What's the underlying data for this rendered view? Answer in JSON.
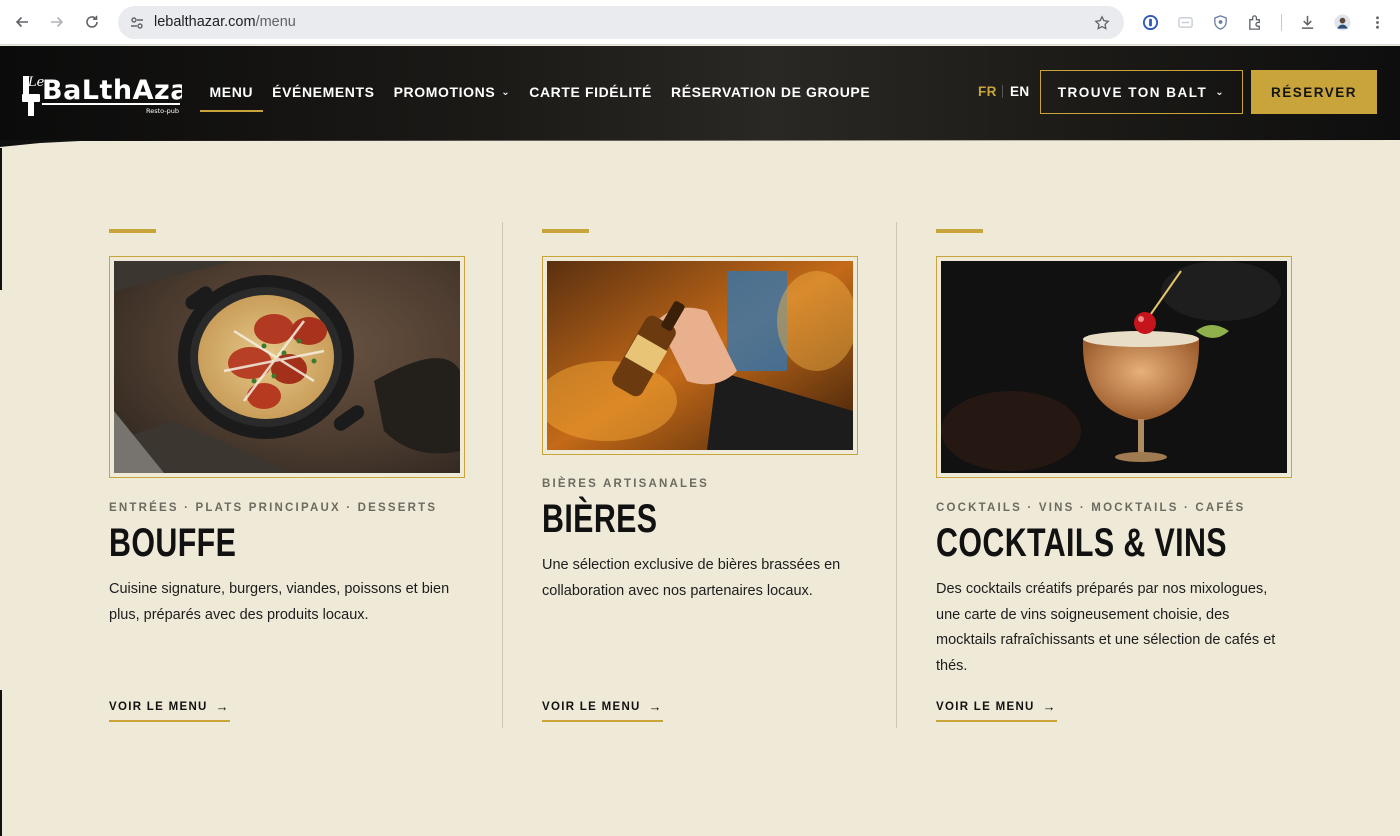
{
  "browser": {
    "url_host": "lebalthazar.com",
    "url_path": "/menu"
  },
  "header": {
    "logo_text": "Le Balthazar",
    "logo_sub": "Resto-pub",
    "nav": [
      {
        "label": "MENU",
        "active": true
      },
      {
        "label": "ÉVÉNEMENTS"
      },
      {
        "label": "PROMOTIONS"
      },
      {
        "label": "CARTE FIDÉLITÉ"
      },
      {
        "label": "RÉSERVATION DE GROUPE"
      }
    ],
    "lang_fr": "FR",
    "lang_en": "EN",
    "find_balt": "TROUVE TON BALT",
    "reserve": "RÉSERVER"
  },
  "sections": [
    {
      "kicker": "ENTRÉES · PLATS PRINCIPAUX · DESSERTS",
      "title": "BOUFFE",
      "description": "Cuisine signature, burgers, viandes, poissons et bien plus, préparés avec des produits locaux.",
      "cta": "VOIR LE MENU"
    },
    {
      "kicker": "BIÈRES ARTISANALES",
      "title": "BIÈRES",
      "description": "Une sélection exclusive de bières brassées en collaboration avec nos partenaires locaux.",
      "cta": "VOIR LE MENU"
    },
    {
      "kicker": "COCKTAILS · VINS · MOCKTAILS · CAFÉS",
      "title": "COCKTAILS & VINS",
      "description": "Des cocktails créatifs préparés par nos mixologues, une carte de vins soigneusement choisie, des mocktails rafraîchissants et une sélection de cafés et thés.",
      "cta": "VOIR LE MENU"
    }
  ],
  "colors": {
    "accent": "#c9a43a",
    "background": "#efe9d8",
    "header": "#1c1a17"
  }
}
